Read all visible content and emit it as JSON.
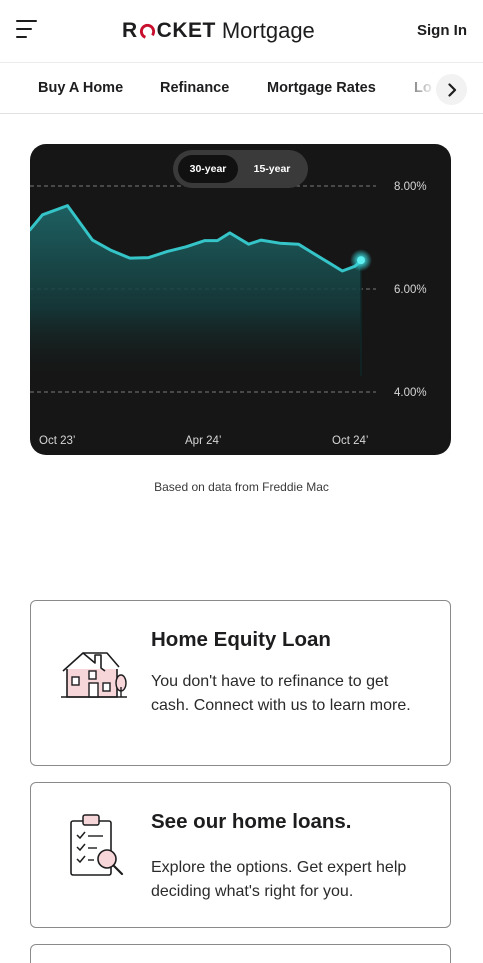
{
  "header": {
    "logo_brand_left": "R",
    "logo_brand_right": "CKET",
    "logo_product": "Mortgage",
    "sign_in": "Sign In"
  },
  "nav": {
    "tabs": [
      {
        "label": "Buy A Home"
      },
      {
        "label": "Refinance"
      },
      {
        "label": "Mortgage Rates"
      },
      {
        "label": "Lo"
      }
    ]
  },
  "rate_chart": {
    "toggle": {
      "selected": "30-year",
      "options": [
        "30-year",
        "15-year"
      ]
    },
    "source_note": "Based on data from Freddie Mac"
  },
  "chart_data": {
    "type": "area",
    "title": "",
    "xlabel": "",
    "ylabel": "",
    "x_tick_labels": [
      "Oct 23’",
      "Apr 24’",
      "Oct 24’"
    ],
    "y_tick_labels": [
      "8.00%",
      "6.00%",
      "4.00%"
    ],
    "y_ticks": [
      8.0,
      6.0,
      4.0
    ],
    "ylim": [
      3.6,
      8.2
    ],
    "grid": "horizontal dashed",
    "x_index": [
      0,
      2,
      6,
      10,
      13,
      16,
      19,
      22,
      25,
      28,
      30,
      32,
      35,
      37,
      40,
      43,
      45,
      48,
      50,
      52,
      53
    ],
    "series": [
      {
        "values": [
          7.15,
          7.44,
          7.62,
          6.95,
          6.75,
          6.6,
          6.61,
          6.73,
          6.82,
          6.94,
          6.94,
          7.09,
          6.87,
          6.95,
          6.89,
          6.87,
          6.72,
          6.5,
          6.35,
          6.44,
          6.54
        ]
      }
    ],
    "colors": {
      "line": "#35c4c7",
      "fill_top": "#1e5e60",
      "marker_glow": "#38d6d8"
    }
  },
  "cards": [
    {
      "icon": "house-icon",
      "title": "Home Equity Loan",
      "description": "You don't have to refinance to get cash. Connect with us to learn more."
    },
    {
      "icon": "checklist-search-icon",
      "title": "See our home loans.",
      "description": "Explore the options. Get expert help deciding what's right for you."
    }
  ],
  "colors": {
    "brand_red": "#c8102e",
    "text": "#1d1d1f",
    "chart_bg": "#161616"
  }
}
